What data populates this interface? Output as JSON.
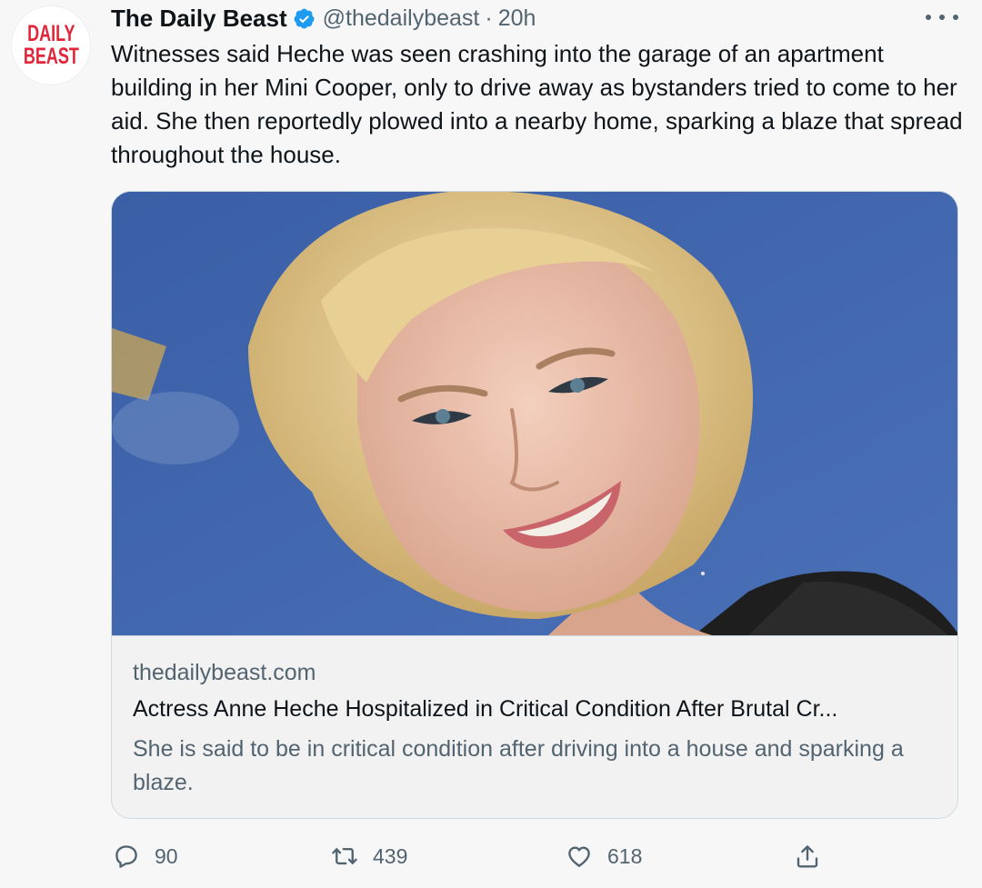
{
  "author": {
    "avatar_logo": [
      "DAILY",
      "BEAST"
    ],
    "display_name": "The Daily Beast",
    "handle": "@thedailybeast",
    "separator": "·",
    "time": "20h",
    "verified_icon": "verified-badge-icon",
    "verified_color": "#1d9bf0"
  },
  "tweet": {
    "text": "Witnesses said Heche was seen crashing into the garage of an apartment building in her Mini Cooper, only to drive away as bystanders tried to come to her aid. She then reportedly plowed into a nearby home, sparking a blaze that spread throughout the house."
  },
  "card": {
    "image_icon": "article-photo",
    "domain": "thedailybeast.com",
    "title": "Actress Anne Heche Hospitalized in Critical Condition After Brutal Cr...",
    "description": "She is said to be in critical condition after driving into a house and sparking a blaze."
  },
  "actions": {
    "reply_count": "90",
    "retweet_count": "439",
    "like_count": "618",
    "reply_icon": "reply-icon",
    "retweet_icon": "retweet-icon",
    "like_icon": "heart-icon",
    "share_icon": "share-icon"
  },
  "colors": {
    "text_primary": "#0f1419",
    "text_secondary": "#536471",
    "brand_red": "#e2263a",
    "card_border": "#cfd9de"
  }
}
